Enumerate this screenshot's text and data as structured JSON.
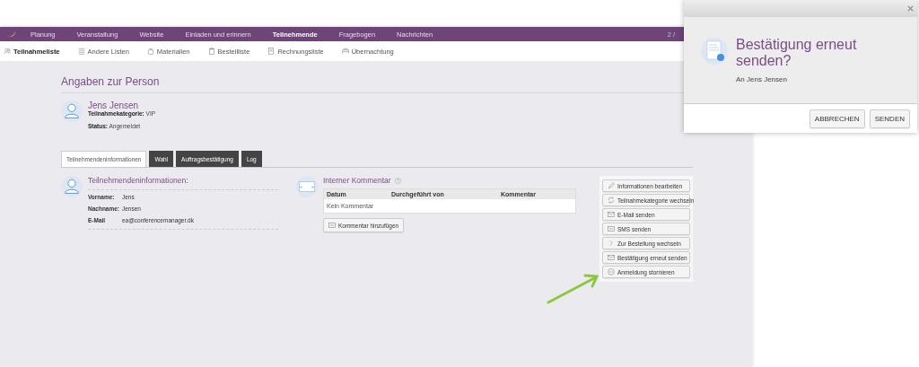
{
  "nav": {
    "items": [
      {
        "label": "Planung",
        "selected": false
      },
      {
        "label": "Veranstaltung",
        "selected": false
      },
      {
        "label": "Website",
        "selected": false
      },
      {
        "label": "Einladen und erinnern",
        "selected": false
      },
      {
        "label": "Teilnehmende",
        "selected": true
      },
      {
        "label": "Fragebogen",
        "selected": false
      },
      {
        "label": "Nachrichten",
        "selected": false
      }
    ],
    "counter": "2 /"
  },
  "subnav": {
    "items": [
      {
        "label": "Teilnahmeliste",
        "kind": "people",
        "selected": true
      },
      {
        "label": "Andere Listen",
        "kind": "list",
        "selected": false
      },
      {
        "label": "Materialien",
        "kind": "bag",
        "selected": false
      },
      {
        "label": "Bestellliste",
        "kind": "clipboard",
        "selected": false
      },
      {
        "label": "Rechnungsliste",
        "kind": "document",
        "selected": false
      },
      {
        "label": "Übernachtung",
        "kind": "bed",
        "selected": false
      }
    ]
  },
  "page_title": "Angaben zur Person",
  "person": {
    "name": "Jens Jensen",
    "fields": [
      {
        "label": "Teilnahmekategorie:",
        "value": "VIP"
      },
      {
        "label": "Status:",
        "value": "Angemeldet"
      }
    ]
  },
  "tabs": [
    {
      "label": "Teilnehmendeninformationen",
      "selected": true
    },
    {
      "label": "Wahl",
      "selected": false
    },
    {
      "label": "Auftragsbestätigung",
      "selected": false
    },
    {
      "label": "Log",
      "selected": false
    }
  ],
  "info": {
    "title": "Teilnehmendeninformationen:",
    "fields": [
      {
        "label": "Vorname:",
        "value": "Jens"
      },
      {
        "label": "Nachname:",
        "value": "Jensen"
      },
      {
        "label": "E-Mail",
        "value": "ea@conferencemanager.dk"
      }
    ]
  },
  "comment": {
    "title": "Interner Kommentar",
    "columns": [
      "Datum",
      "Durchgeführt von",
      "Kommentar"
    ],
    "empty": "Kein Kommentar",
    "add_button": "Kommentar hinzufügen"
  },
  "actions": [
    {
      "label": "Informationen bearbeiten",
      "kind": "pencil"
    },
    {
      "label": "Teilnahmekategorie wechseln",
      "kind": "cycle"
    },
    {
      "label": "E-Mail senden",
      "kind": "envelope"
    },
    {
      "label": "SMS senden",
      "kind": "message"
    },
    {
      "label": "Zur Bestellung wechseln",
      "kind": "chevron"
    },
    {
      "label": "Bestätigung erneut senden",
      "kind": "envelope"
    },
    {
      "label": "Anmeldung stornieren",
      "kind": "minus"
    }
  ],
  "dialog": {
    "title": "Bestätigung erneut senden?",
    "subtitle": "An Jens Jensen",
    "buttons": [
      "ABBRECHEN",
      "SENDEN"
    ]
  }
}
